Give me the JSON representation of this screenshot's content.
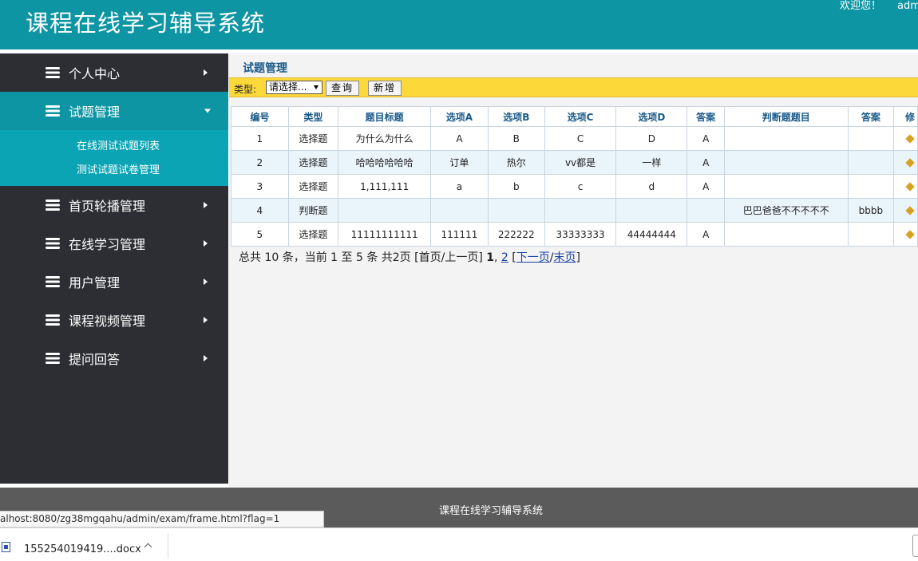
{
  "header": {
    "title": "课程在线学习辅导系统",
    "welcome": "欢迎您！",
    "user": "adm"
  },
  "sidebar": {
    "items": [
      {
        "label": "个人中心",
        "icon": "stack-icon",
        "active": false
      },
      {
        "label": "试题管理",
        "icon": "stack-icon",
        "active": true,
        "children": [
          "在线测试试题列表",
          "测试试题试卷管理"
        ]
      },
      {
        "label": "首页轮播管理",
        "icon": "stack-icon",
        "active": false
      },
      {
        "label": "在线学习管理",
        "icon": "stack-icon",
        "active": false
      },
      {
        "label": "用户管理",
        "icon": "stack-icon",
        "active": false
      },
      {
        "label": "课程视频管理",
        "icon": "stack-icon",
        "active": false
      },
      {
        "label": "提问回答",
        "icon": "stack-icon",
        "active": false
      }
    ]
  },
  "main": {
    "page_title": "试题管理",
    "toolbar": {
      "type_label": "类型:",
      "type_select_value": "请选择...",
      "search_label": "查询",
      "add_label": "新增"
    },
    "table": {
      "headers": [
        "编号",
        "类型",
        "题目标题",
        "选项A",
        "选项B",
        "选项C",
        "选项D",
        "答案",
        "判断题题目",
        "答案",
        "修"
      ],
      "rows": [
        [
          "1",
          "选择题",
          "为什么为什么",
          "A",
          "B",
          "C",
          "D",
          "A",
          "",
          ""
        ],
        [
          "2",
          "选择题",
          "哈哈哈哈哈哈",
          "订单",
          "热尔",
          "vv都是",
          "一样",
          "A",
          "",
          ""
        ],
        [
          "3",
          "选择题",
          "1,111,111",
          "a",
          "b",
          "c",
          "d",
          "A",
          "",
          ""
        ],
        [
          "4",
          "判断题",
          "",
          "",
          "",
          "",
          "",
          "",
          "巴巴爸爸不不不不不",
          "bbbb"
        ],
        [
          "5",
          "选择题",
          "11111111111",
          "111111",
          "222222",
          "33333333",
          "44444444",
          "A",
          "",
          ""
        ]
      ]
    },
    "pager": {
      "summary": "总共 10 条，当前 1 至 5 条 共2页",
      "first_prev": "[首页/上一页]",
      "current_page": "1",
      "comma": ",",
      "page2": "2",
      "next": "下一页",
      "last": "末页"
    }
  },
  "footer": {
    "text": "课程在线学习辅导系统",
    "status_url": "alhost:8080/zg38mgqahu/admin/exam/frame.html?flag=1"
  },
  "download_bar": {
    "file_name": "155254019419....docx",
    "file_icon": "word-doc-icon"
  },
  "colors": {
    "header_bg": "#0e95a4",
    "sidebar_bg": "#2c2e33",
    "active_bg": "#0e95a4",
    "submenu_bg": "#0aa4b4",
    "toolbar_bg": "#fcd938",
    "footer_bg": "#5b5b5b"
  }
}
